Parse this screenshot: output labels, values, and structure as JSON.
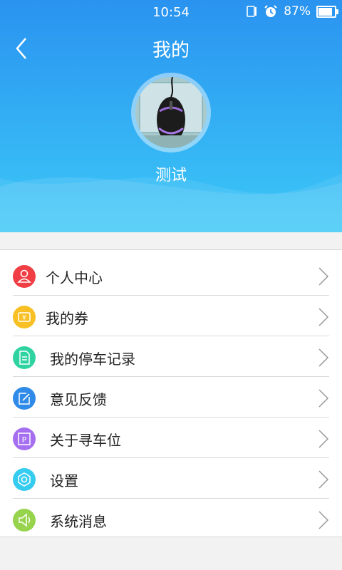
{
  "status_bar": {
    "time": "10:54",
    "battery": "87%",
    "battery_level": 0.87,
    "icons": [
      "sim-icon",
      "alarm-icon",
      "battery-icon"
    ]
  },
  "header": {
    "title": "我的",
    "username": "测试"
  },
  "colors": {
    "header_top": "#2a93f0",
    "header_bottom": "#3cc8f7"
  },
  "menu": {
    "items": [
      {
        "label": "个人中心",
        "icon": "user-icon",
        "color": "#f03e44"
      },
      {
        "label": "我的券",
        "icon": "coupon-icon",
        "color": "#f8c024"
      },
      {
        "label": "我的停车记录",
        "icon": "document-icon",
        "color": "#2fd3a1"
      },
      {
        "label": "意见反馈",
        "icon": "edit-icon",
        "color": "#2f8ae8"
      },
      {
        "label": "关于寻车位",
        "icon": "parking-icon",
        "color": "#a66ff0"
      },
      {
        "label": "设置",
        "icon": "gear-icon",
        "color": "#36ccf0"
      },
      {
        "label": "系统消息",
        "icon": "speaker-icon",
        "color": "#97d34c"
      }
    ]
  }
}
